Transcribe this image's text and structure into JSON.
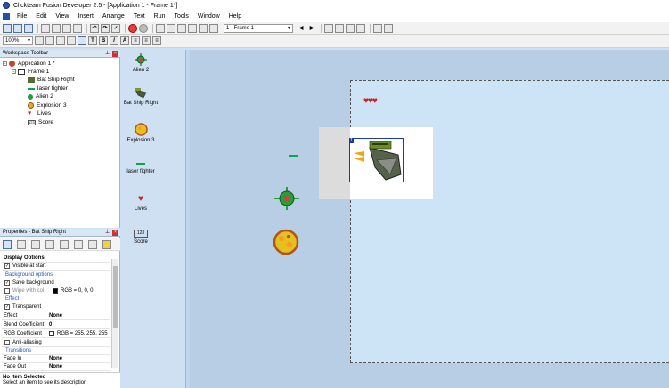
{
  "window": {
    "title": "Clickteam Fusion Developer 2.5 - [Application 1 - Frame 1*]"
  },
  "menu": [
    "File",
    "Edit",
    "View",
    "Insert",
    "Arrange",
    "Text",
    "Run",
    "Tools",
    "Window",
    "Help"
  ],
  "toolbar": {
    "frame_selector": "1 - Frame 1",
    "zoom": "100%"
  },
  "workspace": {
    "title": "Workspace Toolbar",
    "tree": [
      {
        "label": "Application 1 *",
        "icon": "application-icon"
      },
      {
        "label": "Frame 1",
        "icon": "frame-icon"
      },
      {
        "label": "Bat Ship Right",
        "icon": "ship-icon"
      },
      {
        "label": "laser fighter",
        "icon": "laser-icon"
      },
      {
        "label": "Alien 2",
        "icon": "alien-icon"
      },
      {
        "label": "Explosion 3",
        "icon": "explosion-icon"
      },
      {
        "label": "Lives",
        "icon": "heart-icon"
      },
      {
        "label": "Score",
        "icon": "score-icon"
      }
    ]
  },
  "properties": {
    "title": "Properties - Bat Ship Right",
    "rows": [
      {
        "kind": "section",
        "name": "Display Options"
      },
      {
        "kind": "check",
        "name": "Visible at start",
        "checked": true
      },
      {
        "kind": "subsection",
        "name": "Background options"
      },
      {
        "kind": "check",
        "name": "Save background",
        "checked": true
      },
      {
        "kind": "check-value",
        "name": "Wipe with col",
        "checked": false,
        "value": "RGB = 0, 0, 0",
        "color": "#000000"
      },
      {
        "kind": "subsection",
        "name": "Effect"
      },
      {
        "kind": "check",
        "name": "Transparent",
        "checked": true
      },
      {
        "kind": "value",
        "name": "Effect",
        "value": "None"
      },
      {
        "kind": "value",
        "name": "Blend Coefficient",
        "value": "0"
      },
      {
        "kind": "color",
        "name": "RGB Coefficient",
        "value": "RGB = 255, 255, 255",
        "color": "#ffffff"
      },
      {
        "kind": "check",
        "name": "Anti-aliasing",
        "checked": false
      },
      {
        "kind": "subsection",
        "name": "Transitions"
      },
      {
        "kind": "value",
        "name": "Fade In",
        "value": "None"
      },
      {
        "kind": "value",
        "name": "Fade Out",
        "value": "None"
      }
    ],
    "status_title": "No Item Selected",
    "status_desc": "Select an item to see its description"
  },
  "library": [
    {
      "label": "Alien 2",
      "icon": "alien-icon"
    },
    {
      "label": "Bat Ship Right",
      "icon": "ship-icon"
    },
    {
      "label": "Explosion 3",
      "icon": "explosion-icon"
    },
    {
      "label": "laser fighter",
      "icon": "laser-icon"
    },
    {
      "label": "Lives",
      "icon": "heart-icon"
    },
    {
      "label": "Score",
      "icon": "score-icon"
    }
  ],
  "colors": {
    "editor_bg": "#b7cee4",
    "frame_bg": "#cde3f6",
    "selection": "#1a3aa8",
    "lives_heart": "#cc1b2a"
  }
}
